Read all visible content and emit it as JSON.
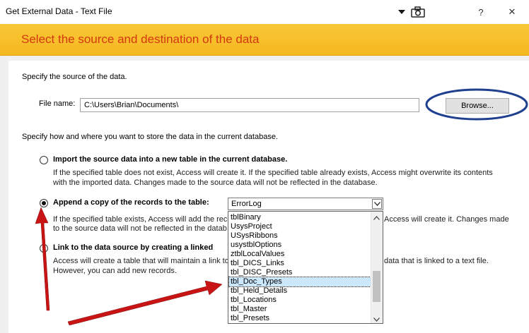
{
  "window": {
    "title": "Get External Data - Text File",
    "icons": [
      "dropdown-arrow-icon",
      "camera-icon",
      "help-icon",
      "close-icon"
    ],
    "help_glyph": "?",
    "close_glyph": "✕"
  },
  "banner": {
    "text": "Select the source and destination of the data"
  },
  "source": {
    "heading": "Specify the source of the data.",
    "file_label": "File name:",
    "file_value": "C:\\Users\\Brian\\Documents\\",
    "browse_label": "Browse..."
  },
  "store": {
    "heading": "Specify how and where you want to store the data in the current database."
  },
  "options": {
    "import": {
      "label": "Import the source data into a new table in the current database.",
      "desc1": "If the specified table does not exist, Access will create it. If the specified table already exists, Access might overwrite its contents",
      "desc2": "with the imported data. Changes made to the source data will not be reflected in the database."
    },
    "append": {
      "label": "Append a copy of the records to the table:",
      "combo_value": "ErrorLog",
      "desc1_left": "If the specified table exists, Access will add the reco",
      "desc1_right": "Access will create it. Changes made",
      "desc2_left": "to the source data will not be reflected in the datab"
    },
    "link": {
      "label": "Link to the data source by creating a linked",
      "desc1_left": "Access will create a table that will maintain a link to",
      "desc1_right": "data that is linked to a text file.",
      "desc2": "However, you can add new records."
    }
  },
  "dropdown": {
    "items": [
      "tblBinary",
      "UsysProject",
      "USysRibbons",
      "usystblOptions",
      "ztblLocalValues",
      "tbl_DICS_Links",
      "tbl_DISC_Presets",
      "tbl_Doc_Types",
      "tbl_Held_Details",
      "tbl_Locations",
      "tbl_Master",
      "tbl_Presets"
    ],
    "selected": "tbl_Doc_Types"
  },
  "colors": {
    "banner": "#f7c128",
    "banner_text": "#d4380f",
    "annotation_arrow": "#c81414",
    "highlight_ellipse": "#1f3f8f"
  }
}
